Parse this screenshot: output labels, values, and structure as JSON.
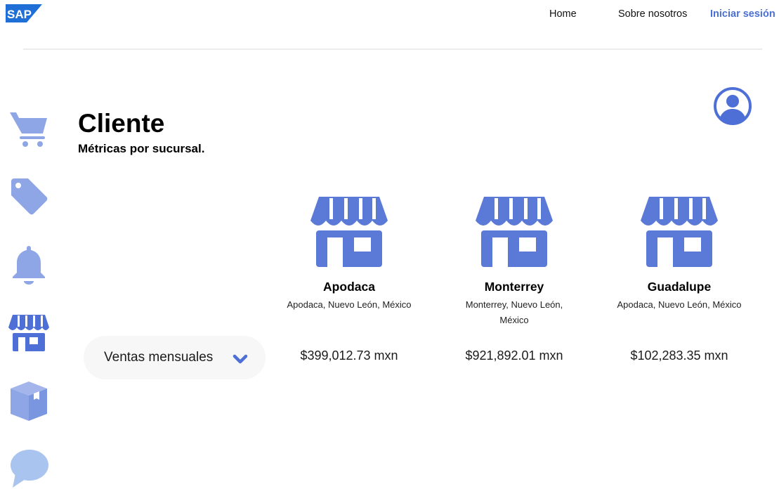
{
  "brand": {
    "logo_text": "SAP",
    "logo_color": "#1f6fd6"
  },
  "nav": {
    "home": "Home",
    "about": "Sobre nosotros",
    "login": "Iniciar sesión",
    "accent_color": "#4a6fd6"
  },
  "sidebar": {
    "items": [
      {
        "icon": "cart-icon"
      },
      {
        "icon": "tag-icon"
      },
      {
        "icon": "bell-icon"
      },
      {
        "icon": "store-icon"
      },
      {
        "icon": "box-icon"
      },
      {
        "icon": "chat-icon"
      }
    ]
  },
  "page": {
    "title": "Cliente",
    "subtitle": "Métricas por sucursal."
  },
  "dropdown": {
    "selected": "Ventas mensuales"
  },
  "branches": [
    {
      "name": "Apodaca",
      "location": "Apodaca, Nuevo León, México",
      "amount": "$399,012.73 mxn"
    },
    {
      "name": "Monterrey",
      "location": "Monterrey, Nuevo León, México",
      "amount": "$921,892.01 mxn"
    },
    {
      "name": "Guadalupe",
      "location": "Apodaca, Nuevo León, México",
      "amount": "$102,283.35 mxn"
    }
  ],
  "colors": {
    "icon_blue": "#5b7ad8",
    "icon_light": "#8ea6e6"
  }
}
